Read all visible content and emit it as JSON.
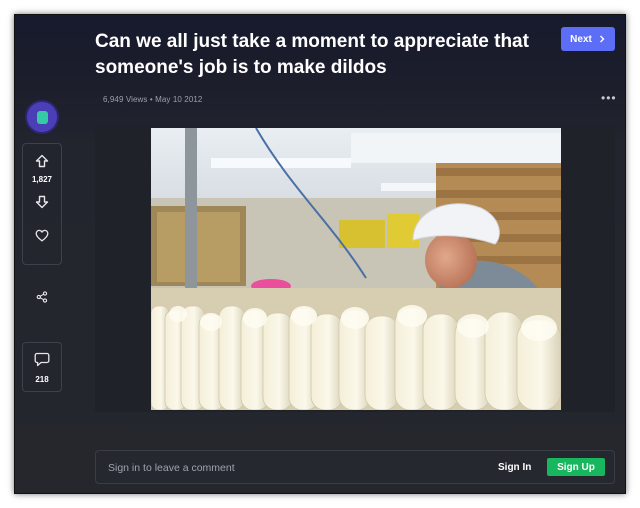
{
  "post": {
    "title": "Can we all just take a moment to appreciate that someone's job is to make dildos",
    "views": "6,949 Views",
    "separator": "•",
    "date": "May 10 2012"
  },
  "nav": {
    "next_label": "Next"
  },
  "sidebar": {
    "vote_count": "1,827",
    "comment_count": "218"
  },
  "comment": {
    "placeholder": "Sign in to leave a comment",
    "signin_label": "Sign In",
    "signup_label": "Sign Up"
  },
  "icons": [
    "chevron-right-icon",
    "more-icon",
    "upvote-icon",
    "downvote-icon",
    "heart-icon",
    "share-icon",
    "comment-icon"
  ],
  "colors": {
    "next_button": "#5c6ef6",
    "signup_button": "#18b65e",
    "avatar": "#4b3fb8"
  }
}
